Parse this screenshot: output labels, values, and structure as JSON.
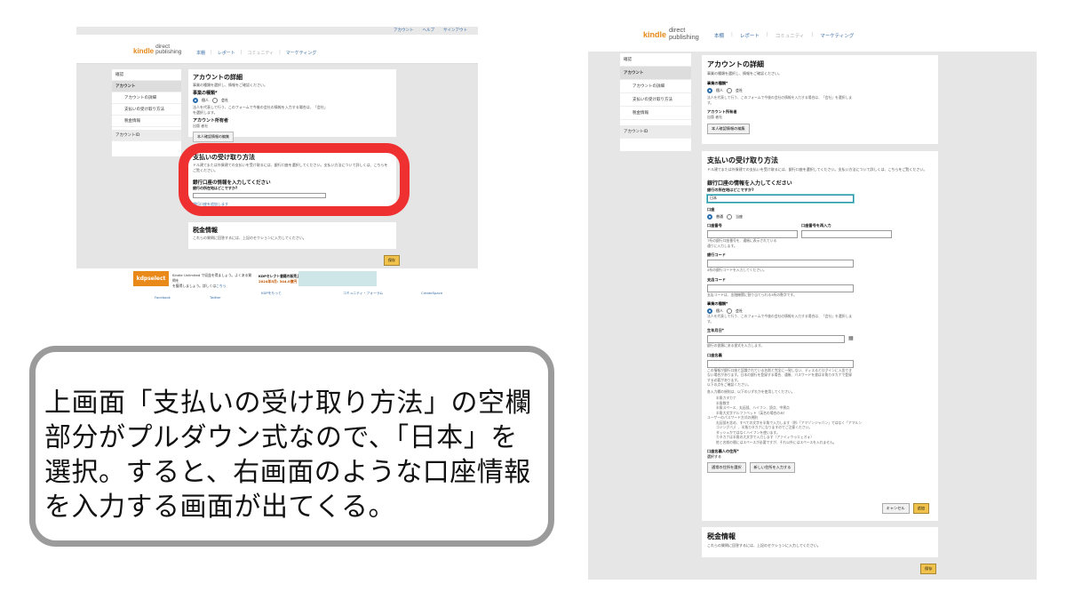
{
  "left": {
    "topbar_links": [
      "アカウント",
      "ヘルプ",
      "サインアウト"
    ],
    "logo": {
      "kindle": "kindle",
      "direct": "direct",
      "publishing": "publishing"
    },
    "nav": [
      "本棚",
      "レポート",
      "コミュニティ",
      "マーケティング"
    ],
    "sidebar": {
      "top": "確認",
      "account": "アカウント",
      "items": [
        "アカウントの詳細",
        "支払いの受け取り方法",
        "税金情報"
      ],
      "account_id": "アカウントID"
    },
    "details": {
      "title": "アカウントの詳細",
      "subtitle": "事業の種類を選択し、情報をご確認ください。",
      "biz_label": "事業の種類*",
      "opt1": "個人",
      "opt2": "会社",
      "note": "法人を代表して行う、このフォームで今後の会社の情報を入力する場合は、「会社」を選択します。",
      "holder_label": "アカウント所有者",
      "holder_name": "出版 者社",
      "edit_button": "本人確認情報の編集"
    },
    "payment": {
      "title": "支払いの受け取り方法",
      "desc": "ドル建てまたは外貨建ての支払いを受け取るには、銀行口座を選択してください。支払い方法について詳しくは、こちらをご覧ください。",
      "bank_heading": "銀行口座の情報を入力してください",
      "bank_q": "銀行の所在地はどこですか?",
      "link": "銀行口座を追加します"
    },
    "tax": {
      "title": "税金情報",
      "desc": "これらの質問に回答するには、上記のセクションに入力してください。"
    },
    "save": "保存",
    "promo": {
      "kdpselect": "kdpselect",
      "text1": "Kindle Unlimited で収益を得ましょう。よくある質問を",
      "text2": "を獲得しましょう。詳しくは",
      "text3": "こちら",
      "kdp_title": "KDPセレクト書籍の販売上",
      "kdp_sub": "2024年5月: 344.0億円"
    },
    "footer": [
      "Facebook",
      "Twitter",
      "KDPをもっと",
      "コミュニティ・フォーラム",
      "CreateSpace"
    ]
  },
  "callout": {
    "text": "上画面「支払いの受け取り方法」の空欄部分がプルダウン式なので、「日本」を選択。すると、右画面のような口座情報を入力する画面が出てくる。"
  },
  "right": {
    "logo": {
      "kindle": "kindle",
      "direct": "direct",
      "publishing": "publishing"
    },
    "nav": [
      "本棚",
      "レポート",
      "コミュニティ",
      "マーケティング"
    ],
    "sidebar": {
      "top": "確認",
      "account": "アカウント",
      "items": [
        "アカウントの詳細",
        "支払いの受け取り方法",
        "税金情報"
      ],
      "account_id": "アカウントID"
    },
    "details": {
      "title": "アカウントの詳細",
      "subtitle": "事業の種類を選択し、情報をご確認ください。",
      "biz_label": "事業の種類*",
      "opt1": "個人",
      "opt2": "会社",
      "note": "法人を代表して行う、このフォームで今後の会社の情報を入力する場合は、「会社」を選択します。",
      "holder_label": "アカウント所有者",
      "holder_name": "出版 者社",
      "edit_button": "本人確認情報の編集"
    },
    "payment": {
      "title": "支払いの受け取り方法",
      "desc": "ドル建てまたは外貨建ての支払いを受け取るには、銀行口座を選択してください。支払い方法について詳しくは、こちらをご覧ください。",
      "bank_heading": "銀行口座の情報を入力してください",
      "bank_q": "銀行の所在地はどこですか?",
      "bank_value": "日本",
      "acct_type_label": "口座",
      "acct_opt1": "普通",
      "acct_opt2": "当座",
      "acct_no_label": "口座番号",
      "acct_no_confirm": "口座番号を再入力",
      "acct_no_hint": "7桁の銀行口座番号を、通帳に表示されている通りに入力します。",
      "bank_code_label": "銀行コード",
      "bank_code_hint": "4桁の銀行コードを入力してください。",
      "branch_label": "支店コード",
      "branch_hint": "支店コードは、金融機関に割り当てられる3桁の数字です。",
      "biz2_label": "事業の種類*",
      "biz2_opt1": "個人",
      "biz2_opt2": "会社",
      "biz2_note": "法人を代表して行う、このフォームで今後の会社の情報を入力する場合は、「会社」を選択します。",
      "dob_label": "生年月日*",
      "dob_hint": "銀行の書類にある書式を入力します。",
      "name_label": "口座名義",
      "name_hint": "この情報が銀行口座と認識されている名前と完全に一致しない、ディスるとログインに入金できない場合があります。日本の銀行を登録する場合、通帳、パスワードを書は半角カタカナで登録する必要があります。",
      "name_hint2": "以下の点をご確認ください。",
      "name_hint3": "各入力欄の規則は、以下のいずれかを使用してください。",
      "rules": [
        "半角カタカナ",
        "半角数字",
        "半角スペース、丸括弧、ハイフン、読点、中黒点",
        "半角大文字アルファベット（英名の場合のみ）"
      ],
      "rules_note": "ユーザーのパスワード方式の規則",
      "rules2": [
        "丸括弧を含め、すべての文字を半角で入力します（例:「アマゾンジャパン」ではなく「アマルンゴジングバ」）、半角カタカナになりますのでご注意ください。",
        "ダッシュかではなくハイフンを使います。",
        "カタカナは半角の大文字で入力します（アァイィウゥエェオォ）",
        "姓と名前の間にはスペースが必要ですが、それ以外にはスペースを入れません。"
      ],
      "holder_q": "口座名義人の住所*",
      "holder_choose": "選択する",
      "btn_existing": "通常の住所を選択",
      "btn_new": "新しい住所を入力する",
      "cancel": "キャンセル",
      "add": "追加"
    },
    "tax": {
      "title": "税金情報",
      "desc": "これらの質問に回答するには、上記のセクションに入力してください。"
    },
    "save": "保存"
  }
}
